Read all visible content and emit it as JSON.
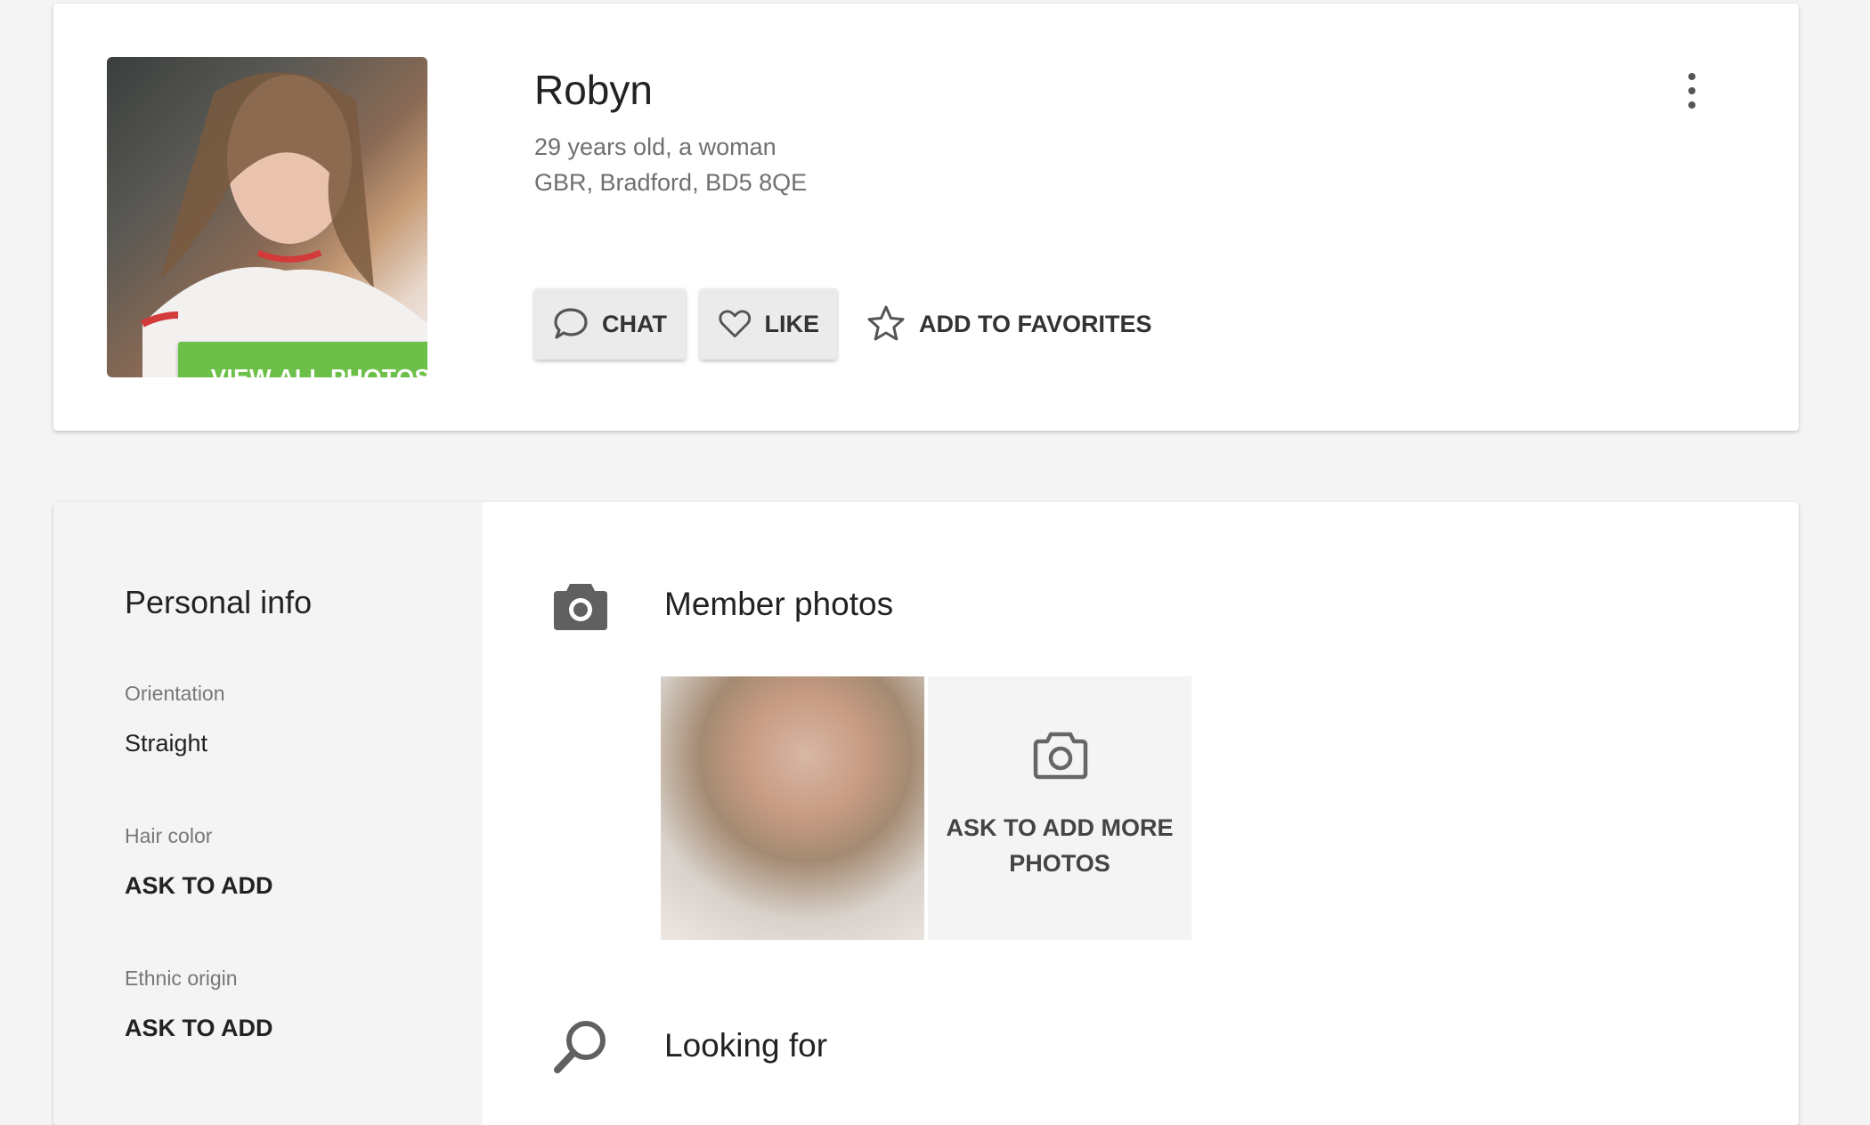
{
  "profile": {
    "name": "Robyn",
    "age_gender": "29 years old, a woman",
    "location": "GBR, Bradford, BD5 8QE",
    "view_photos_label": "VIEW ALL PHOTOS",
    "actions": {
      "chat": "CHAT",
      "like": "LIKE",
      "favorites": "ADD TO FAVORITES"
    }
  },
  "personal_info": {
    "title": "Personal info",
    "fields": [
      {
        "label": "Orientation",
        "value": "Straight"
      },
      {
        "label": "Hair color",
        "value": "ASK TO ADD"
      },
      {
        "label": "Ethnic origin",
        "value": "ASK TO ADD"
      }
    ]
  },
  "sections": {
    "photos_title": "Member photos",
    "ask_more": "ASK TO ADD MORE PHOTOS",
    "looking_for_title": "Looking for"
  },
  "colors": {
    "accent_green": "#6cc04a",
    "background": "#f4f4f4"
  }
}
